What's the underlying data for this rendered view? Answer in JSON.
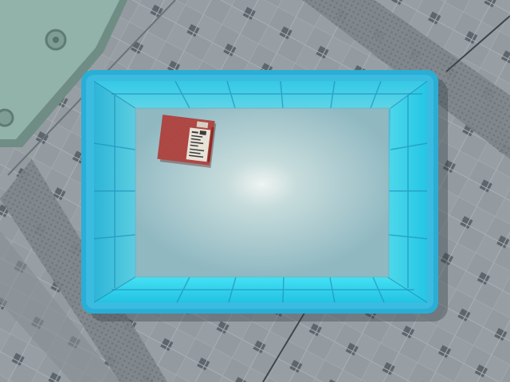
{
  "scene": {
    "description_free": true,
    "colors": {
      "pavement": "#8f979c",
      "pavement_tile_dark": "#6f777d",
      "pavement_textured": "#7a8288",
      "crate_rim": "#2fb3d8",
      "crate_rim_dark": "#1a8fb5",
      "crate_inner_wall": "#38d6ec",
      "crate_floor": "#a9cbd2",
      "crate_floor_light": "#e9f1ee",
      "box_red": "#b23a36",
      "box_label": "#e8e3d8",
      "metal_block": "#8fb0a6"
    },
    "objects": [
      {
        "name": "pavement",
        "interactable": false
      },
      {
        "name": "metal-block",
        "interactable": false
      },
      {
        "name": "blue-plastic-crate",
        "interactable": false
      },
      {
        "name": "red-cardboard-box",
        "interactable": false
      }
    ]
  }
}
